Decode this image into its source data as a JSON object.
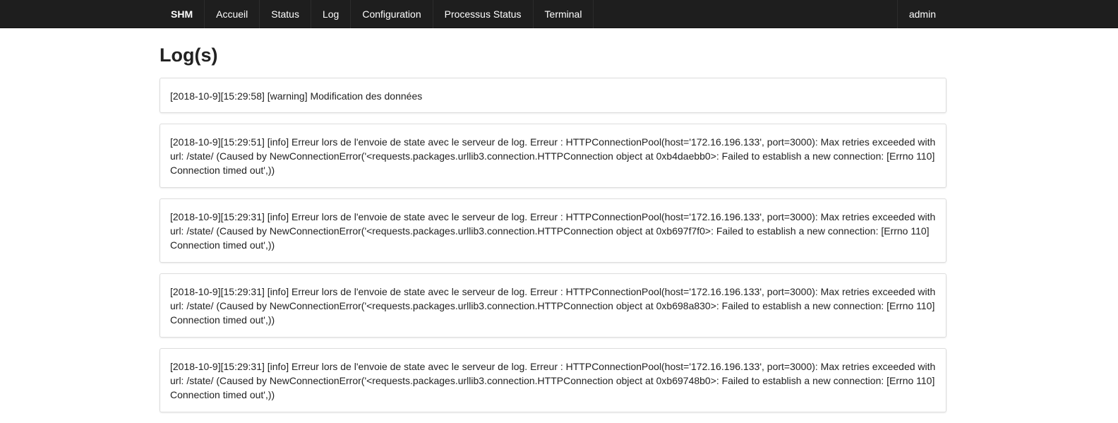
{
  "navbar": {
    "brand": "SHM",
    "items": [
      {
        "label": "Accueil"
      },
      {
        "label": "Status"
      },
      {
        "label": "Log"
      },
      {
        "label": "Configuration"
      },
      {
        "label": "Processus Status"
      },
      {
        "label": "Terminal"
      }
    ],
    "user": "admin",
    "colors": {
      "background": "#1e1e1e",
      "text": "#ffffff"
    }
  },
  "page": {
    "title": "Log(s)"
  },
  "logs": [
    {
      "text": "[2018-10-9][15:29:58] [warning] Modification des données"
    },
    {
      "text": "[2018-10-9][15:29:51] [info] Erreur lors de l'envoie de state avec le serveur de log. Erreur : HTTPConnectionPool(host='172.16.196.133', port=3000): Max retries exceeded with url: /state/ (Caused by NewConnectionError('<requests.packages.urllib3.connection.HTTPConnection object at 0xb4daebb0>: Failed to establish a new connection: [Errno 110] Connection timed out',))"
    },
    {
      "text": "[2018-10-9][15:29:31] [info] Erreur lors de l'envoie de state avec le serveur de log. Erreur : HTTPConnectionPool(host='172.16.196.133', port=3000): Max retries exceeded with url: /state/ (Caused by NewConnectionError('<requests.packages.urllib3.connection.HTTPConnection object at 0xb697f7f0>: Failed to establish a new connection: [Errno 110] Connection timed out',))"
    },
    {
      "text": "[2018-10-9][15:29:31] [info] Erreur lors de l'envoie de state avec le serveur de log. Erreur : HTTPConnectionPool(host='172.16.196.133', port=3000): Max retries exceeded with url: /state/ (Caused by NewConnectionError('<requests.packages.urllib3.connection.HTTPConnection object at 0xb698a830>: Failed to establish a new connection: [Errno 110] Connection timed out',))"
    },
    {
      "text": "[2018-10-9][15:29:31] [info] Erreur lors de l'envoie de state avec le serveur de log. Erreur : HTTPConnectionPool(host='172.16.196.133', port=3000): Max retries exceeded with url: /state/ (Caused by NewConnectionError('<requests.packages.urllib3.connection.HTTPConnection object at 0xb69748b0>: Failed to establish a new connection: [Errno 110] Connection timed out',))"
    }
  ]
}
